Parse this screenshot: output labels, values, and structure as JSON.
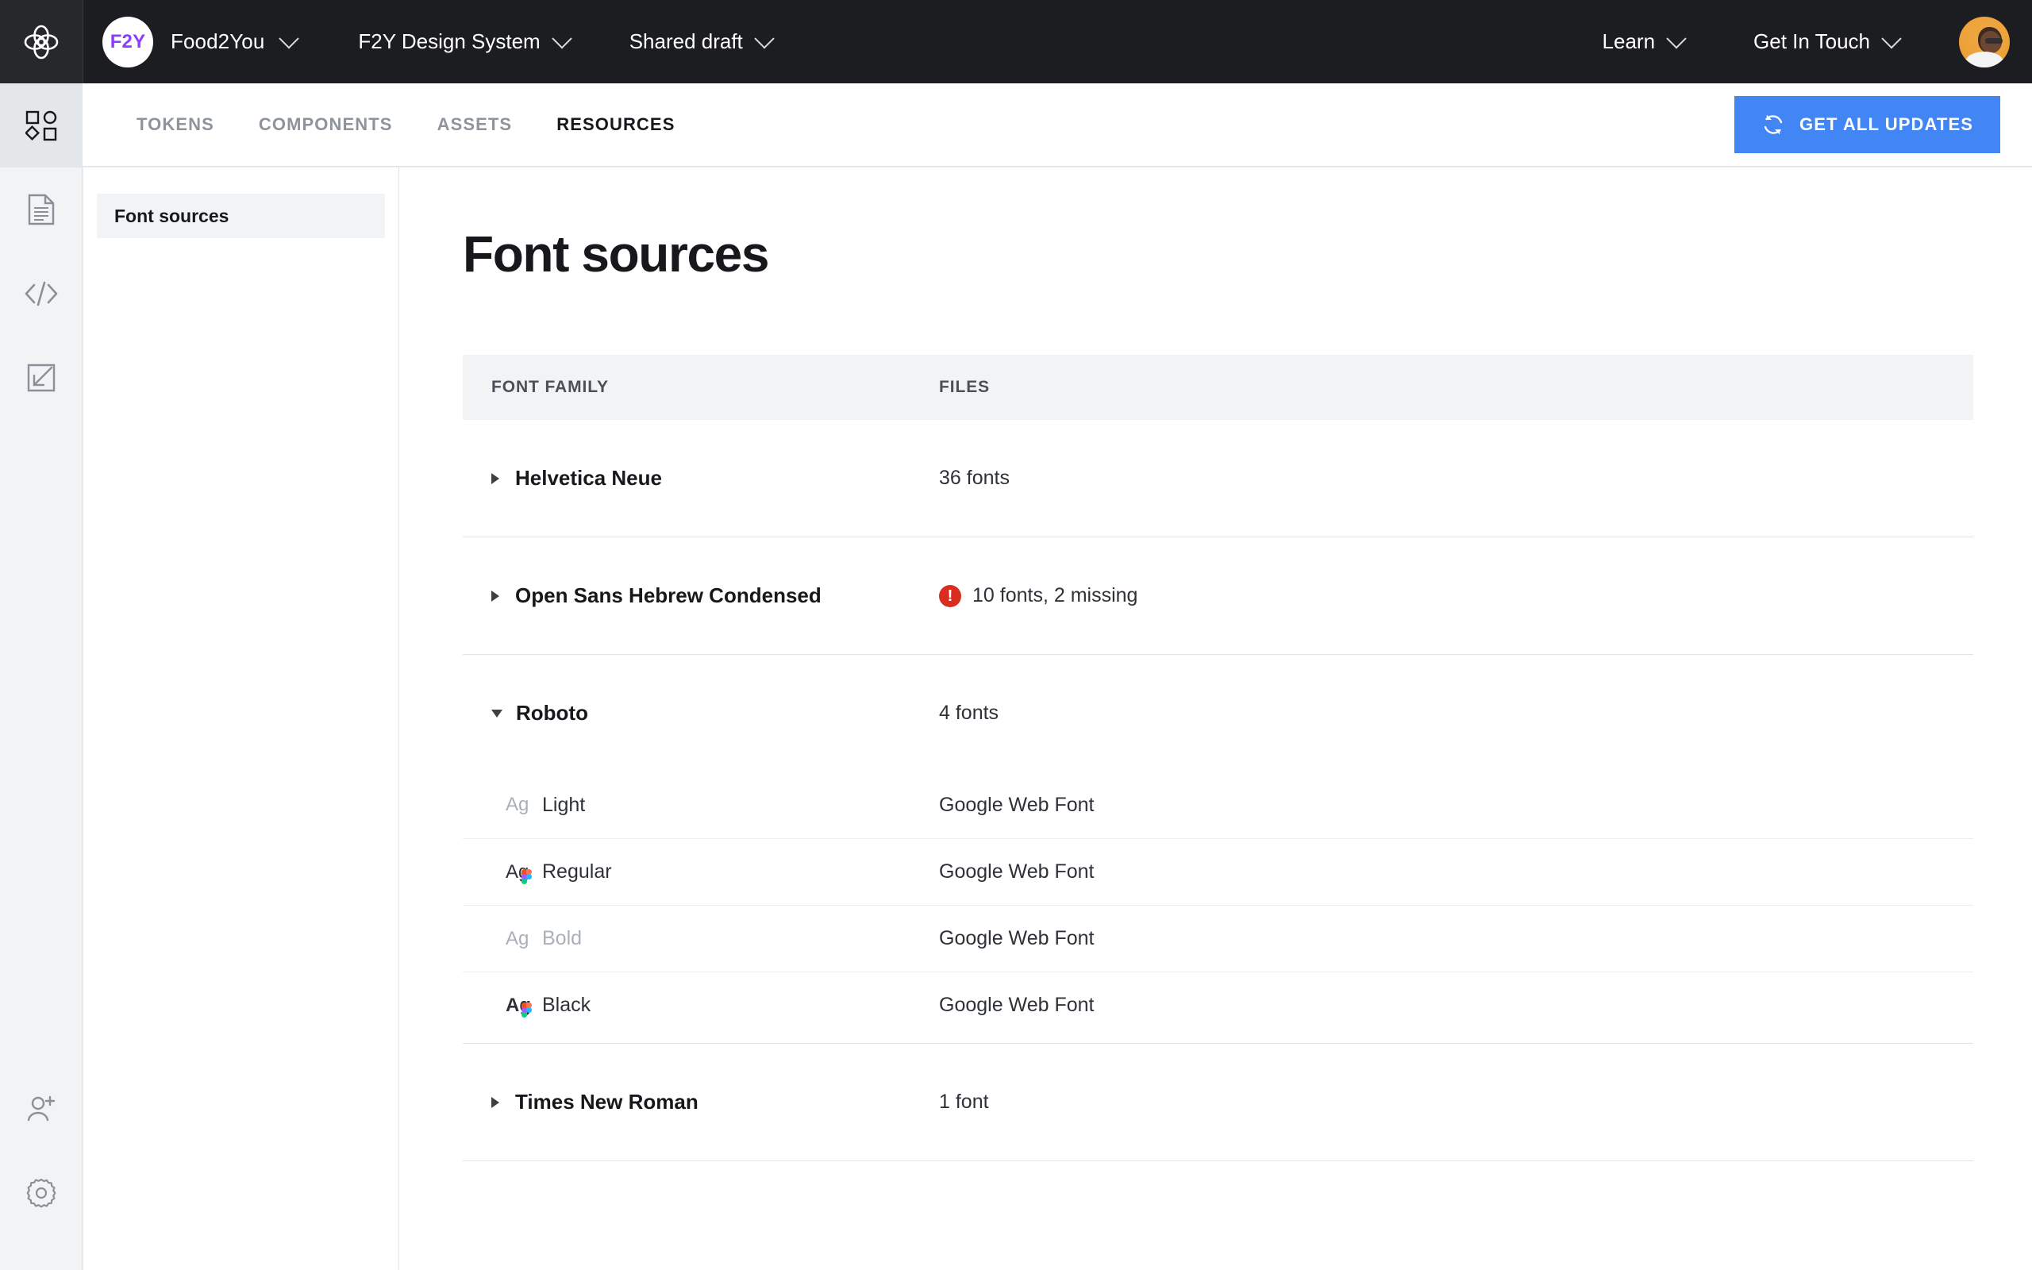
{
  "topbar": {
    "logo_icon": "supernova-knot-logo",
    "workspace_badge": "F2Y",
    "workspace_name": "Food2You",
    "design_system": "F2Y Design System",
    "version": "Shared draft",
    "learn": "Learn",
    "get_in_touch": "Get In Touch",
    "avatar_label": "user-avatar",
    "background_color": "#1b1d21",
    "badge_text_color": "#8b3dff"
  },
  "rail": {
    "items": [
      {
        "name": "design-system-icon",
        "active": true
      },
      {
        "name": "documentation-icon",
        "active": false
      },
      {
        "name": "code-icon",
        "active": false
      },
      {
        "name": "import-icon",
        "active": false
      }
    ],
    "bottom_items": [
      {
        "name": "add-user-icon"
      },
      {
        "name": "settings-gear-icon"
      }
    ]
  },
  "subbar": {
    "tabs": [
      {
        "label": "TOKENS",
        "active": false
      },
      {
        "label": "COMPONENTS",
        "active": false
      },
      {
        "label": "ASSETS",
        "active": false
      },
      {
        "label": "RESOURCES",
        "active": true
      }
    ],
    "update_button": {
      "label": "GET ALL UPDATES",
      "icon": "refresh-icon",
      "color": "#4285f4"
    }
  },
  "navpanel": {
    "items": [
      {
        "label": "Font sources",
        "active": true
      }
    ]
  },
  "main": {
    "title": "Font sources",
    "table": {
      "headers": {
        "family": "FONT FAMILY",
        "files": "FILES"
      },
      "rows": [
        {
          "family": "Helvetica Neue",
          "files": "36 fonts",
          "expanded": false,
          "error": false,
          "children": []
        },
        {
          "family": "Open Sans Hebrew Condensed",
          "files": "10 fonts, 2 missing",
          "expanded": false,
          "error": true,
          "error_icon": "error-exclamation-icon",
          "children": []
        },
        {
          "family": "Roboto",
          "files": "4 fonts",
          "expanded": true,
          "error": false,
          "children": [
            {
              "glyph": "Ag",
              "style": "Light",
              "source": "Google Web Font",
              "missing": false,
              "figma": false,
              "bold_glyph": false
            },
            {
              "glyph": "Ag",
              "style": "Regular",
              "source": "Google Web Font",
              "missing": false,
              "figma": true,
              "bold_glyph": false
            },
            {
              "glyph": "Ag",
              "style": "Bold",
              "source": "Google Web Font",
              "missing": true,
              "figma": false,
              "bold_glyph": false
            },
            {
              "glyph": "Ag",
              "style": "Black",
              "source": "Google Web Font",
              "missing": false,
              "figma": true,
              "bold_glyph": true
            }
          ]
        },
        {
          "family": "Times New Roman",
          "files": "1 font",
          "expanded": false,
          "error": false,
          "children": []
        }
      ]
    }
  },
  "colors": {
    "error": "#d92d20",
    "accent_blue": "#4285f4",
    "brand_purple": "#8b3dff",
    "header_bg": "#1b1d21"
  }
}
